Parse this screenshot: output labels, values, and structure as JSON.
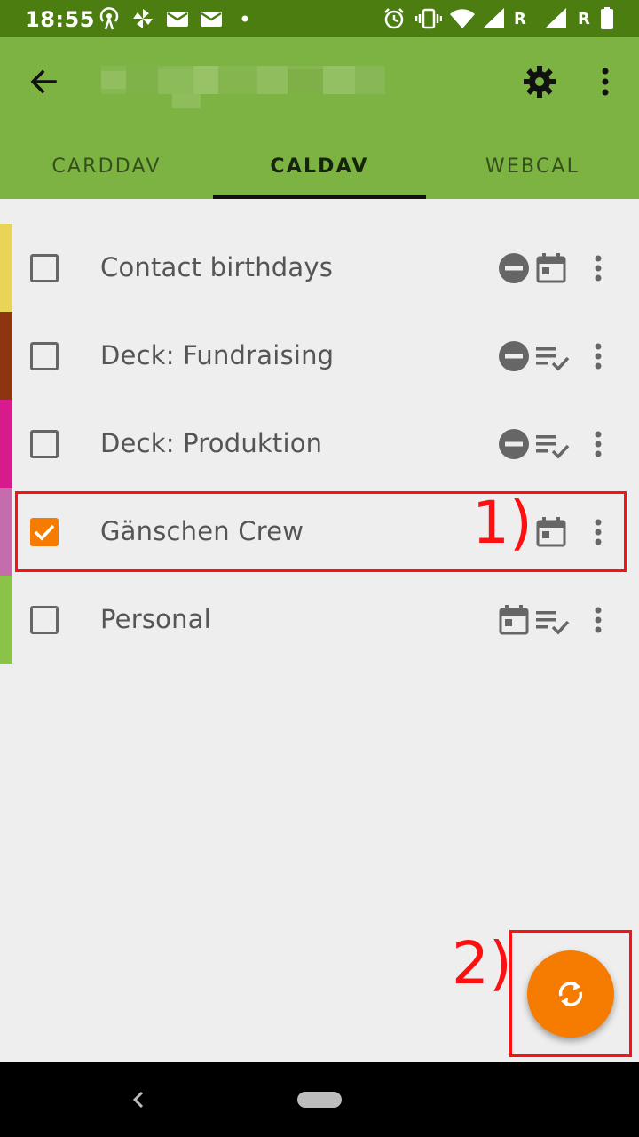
{
  "status_bar": {
    "time": "18:55",
    "sim1_label": "R",
    "sim2_label": "R",
    "icons": [
      "hotspot-icon",
      "pinwheel-icon",
      "mail-icon",
      "mail-icon",
      "dot-icon",
      "alarm-icon",
      "vibrate-icon",
      "wifi-icon",
      "signal-icon",
      "signal-icon",
      "battery-icon"
    ]
  },
  "app_bar": {
    "title_redacted": true,
    "tabs": [
      {
        "label": "CARDDAV",
        "active": false
      },
      {
        "label": "CALDAV",
        "active": true
      },
      {
        "label": "WEBCAL",
        "active": false
      }
    ]
  },
  "calendars": [
    {
      "name": "Contact birthdays",
      "color": "#e9d458",
      "checked": false,
      "icons": [
        "read-only-icon",
        "calendar-icon"
      ]
    },
    {
      "name": "Deck: Fundraising",
      "color": "#8e3411",
      "checked": false,
      "icons": [
        "read-only-icon",
        "tasks-icon"
      ]
    },
    {
      "name": "Deck: Produktion",
      "color": "#d81b8c",
      "checked": false,
      "icons": [
        "read-only-icon",
        "tasks-icon"
      ]
    },
    {
      "name": "Gänschen Crew",
      "color": "#c56cac",
      "checked": true,
      "icons": [
        "calendar-icon"
      ]
    },
    {
      "name": "Personal",
      "color": "#8bc34a",
      "checked": false,
      "icons": [
        "calendar-icon",
        "tasks-icon"
      ]
    }
  ],
  "annotations": {
    "marker_1": "1)",
    "marker_2": "2)"
  },
  "colors": {
    "status_bar": "#4b7d10",
    "app_bar": "#7cb342",
    "accent": "#f57c00",
    "annotation": "#ff1010"
  }
}
